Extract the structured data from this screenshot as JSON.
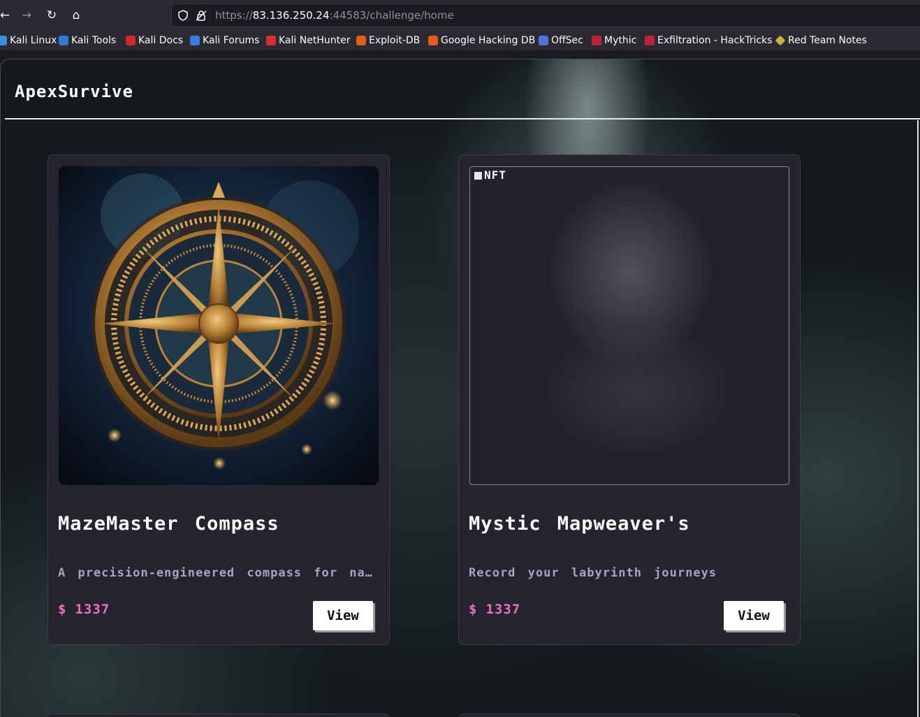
{
  "browser": {
    "url_prefix": "https://",
    "url_host": "83.136.250.24",
    "url_rest": ":44583/challenge/home",
    "bookmarks": [
      {
        "label": "Kali Linux",
        "icon": "kali-dragon-icon",
        "color": "#3d8ce0"
      },
      {
        "label": "Kali Tools",
        "icon": "kali-tools-icon",
        "color": "#2f7bd8"
      },
      {
        "label": "Kali Docs",
        "icon": "kali-docs-icon",
        "color": "#d32a2a"
      },
      {
        "label": "Kali Forums",
        "icon": "kali-forums-icon",
        "color": "#3a7de0"
      },
      {
        "label": "Kali NetHunter",
        "icon": "nethunter-icon",
        "color": "#d83030"
      },
      {
        "label": "Exploit-DB",
        "icon": "exploit-db-icon",
        "color": "#e25c1c"
      },
      {
        "label": "Google Hacking DB",
        "icon": "ghdb-icon",
        "color": "#e25c1c"
      },
      {
        "label": "OffSec",
        "icon": "offsec-icon",
        "color": "#5a6ee0"
      },
      {
        "label": "Mythic",
        "icon": "mythic-icon",
        "color": "#c0203a"
      },
      {
        "label": "Exfiltration - HackTricks",
        "icon": "hacktricks-icon",
        "color": "#c0203a"
      },
      {
        "label": "Red Team Notes",
        "icon": "red-team-notes-icon",
        "color": "#c9b23a"
      }
    ]
  },
  "site": {
    "brand": "ApexSurvive"
  },
  "products": [
    {
      "title": "MazeMaster Compass",
      "description": "A precision-engineered compass for navigating any labyrinth",
      "currency": "$",
      "price": "1337",
      "view_label": "View",
      "image_alt": ""
    },
    {
      "title": "Mystic Mapweaver's",
      "description": "Record your labyrinth journeys",
      "currency": "$",
      "price": "1337",
      "view_label": "View",
      "image_alt": "NFT"
    }
  ]
}
